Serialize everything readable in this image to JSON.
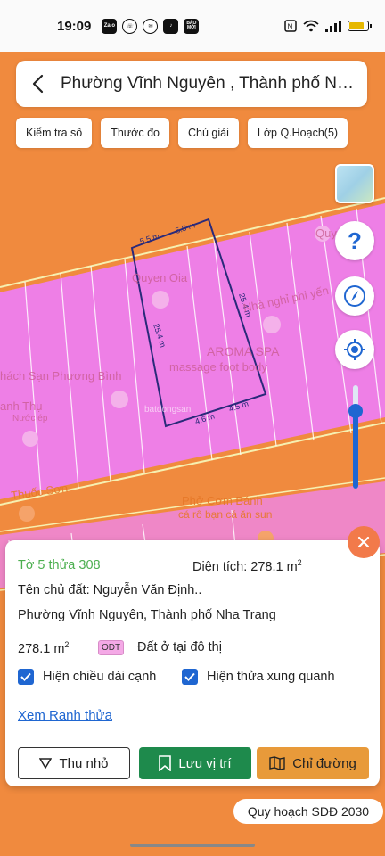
{
  "status_bar": {
    "time": "19:09",
    "apps": [
      "Zalo",
      "Viber",
      "Messenger",
      "TikTok",
      "BÁO MỚI"
    ],
    "battery_level": 0.8
  },
  "search": {
    "title": "Phường Vĩnh Nguyên , Thành phố Nh..."
  },
  "chips": [
    "Kiểm tra số",
    "Thước đo",
    "Chú giải",
    "Lớp Q.Hoạch(5)"
  ],
  "map": {
    "labels": [
      "Quyen Oia",
      "Nhà nghỉ phi yến",
      "AROMA SPA",
      "massage foot body",
      "hách Sạn Phương Bình",
      "anh Thụ",
      "Nước ép",
      "Thuốc Sơn",
      "Phở Cơm Bánh",
      "cá rô bạn cá ăn sun",
      "Quy"
    ],
    "edge_lengths": [
      "5.5 m",
      "5.5 m",
      "25.4 m",
      "25.4 m",
      "4.6 m",
      "4.5 m"
    ],
    "watermark": "batdongsan"
  },
  "zoom_level": 0.75,
  "card": {
    "parcel": "Tờ 5 thửa 308",
    "area_label": "Diện tích: 278.1 m",
    "area_unit_sup": "2",
    "owner": "Tên chủ đất: Nguyễn Văn Định..",
    "address": "Phường Vĩnh Nguyên, Thành phố Nha Trang",
    "area_value": "278.1 m",
    "land_code": "ODT",
    "land_type": "Đất ở tại đô thị",
    "checkbox_edges": "Hiện chiều dài cạnh",
    "checkbox_neighbors": "Hiện thửa xung quanh",
    "link_boundary": "Xem Ranh thửa",
    "btn_minimize": "Thu nhỏ",
    "btn_save": "Lưu vị trí",
    "btn_directions": "Chỉ đường"
  },
  "plan_badge": "Quy hoạch SDĐ 2030",
  "colors": {
    "orange": "#f08a3e",
    "pink": "#ee7fe6",
    "blue": "#1f66d1",
    "green": "#1e8a4c"
  }
}
